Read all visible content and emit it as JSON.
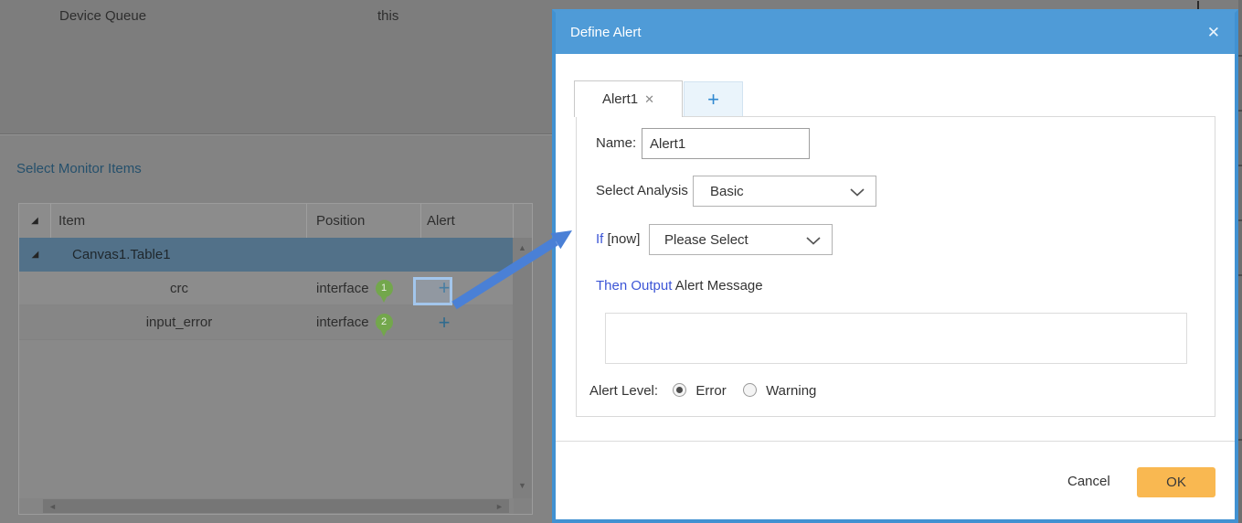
{
  "background": {
    "top_labels": {
      "device_queue": "Device Queue",
      "this_text": "this"
    },
    "section_title": "Select Monitor Items",
    "table": {
      "headers": {
        "item": "Item",
        "position": "Position",
        "alert": "Alert"
      },
      "group_row": {
        "item": "Canvas1.Table1"
      },
      "rows": [
        {
          "item": "crc",
          "position": "interface",
          "pin": "1",
          "add": "+",
          "highlighted": true
        },
        {
          "item": "input_error",
          "position": "interface",
          "pin": "2",
          "add": "+",
          "highlighted": false
        }
      ]
    }
  },
  "modal": {
    "title": "Define Alert",
    "tabs": {
      "active_label": "Alert1",
      "add_label": "+"
    },
    "form": {
      "name_label": "Name:",
      "name_value": "Alert1",
      "analysis_label": "Select Analysis",
      "analysis_value": "Basic",
      "if_label": "If",
      "if_bracket": "[now]",
      "condition_value": "Please Select",
      "then_label": "Then Output",
      "then_text": "Alert Message",
      "level_label": "Alert Level:",
      "level_options": [
        {
          "label": "Error",
          "selected": true
        },
        {
          "label": "Warning",
          "selected": false
        }
      ]
    },
    "footer": {
      "cancel_label": "Cancel",
      "ok_label": "OK"
    }
  },
  "icons": {
    "close": "✕",
    "tab_close": "✕",
    "expander": "◢",
    "scroll_up": "▲",
    "scroll_down": "▼",
    "scroll_left": "◄",
    "scroll_right": "►"
  },
  "colors": {
    "titlebar_blue": "#4f9bd7",
    "modal_border_blue": "#4191d1",
    "keyword_blue": "#3c55d6",
    "ok_amber": "#f9b851",
    "pin_green": "#73a74c",
    "plus_teal": "#2f6b8e",
    "selected_row_teal": "#527189",
    "arrow_blue": "#4a80d6",
    "highlight_box": "#a3c6ec"
  }
}
